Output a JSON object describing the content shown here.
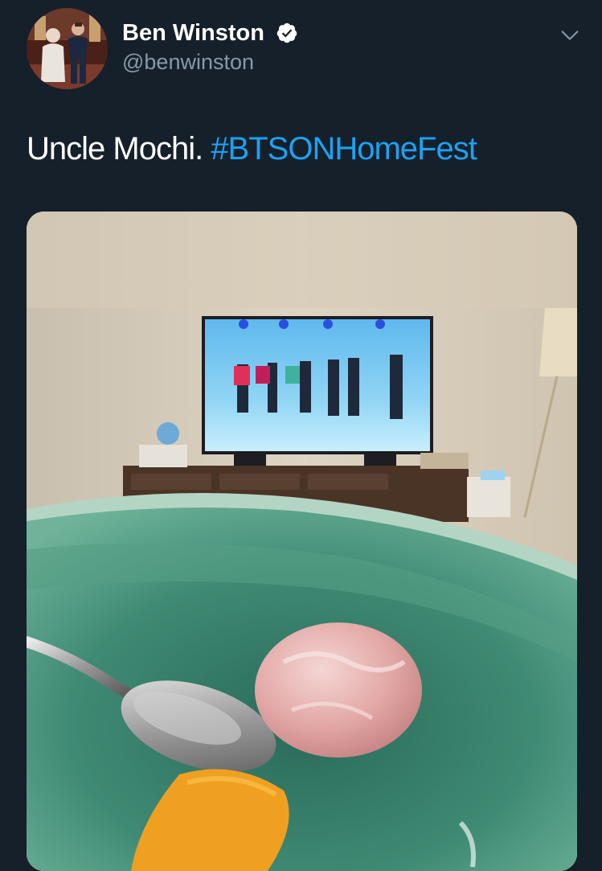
{
  "tweet": {
    "author": {
      "display_name": "Ben Winston",
      "handle": "@benwinston",
      "verified": true,
      "verified_icon": "verified-badge-icon",
      "avatar": "profile-photo"
    },
    "menu_icon": "chevron-down-icon",
    "text": {
      "plain": "Uncle Mochi. ",
      "hashtag": "#BTSONHomeFest"
    },
    "media": {
      "type": "photo",
      "subject": "mochi in green bowl in front of TV"
    }
  },
  "colors": {
    "background": "#15202b",
    "primary_text": "#ffffff",
    "secondary_text": "#8899a6",
    "accent": "#1da1f2"
  }
}
